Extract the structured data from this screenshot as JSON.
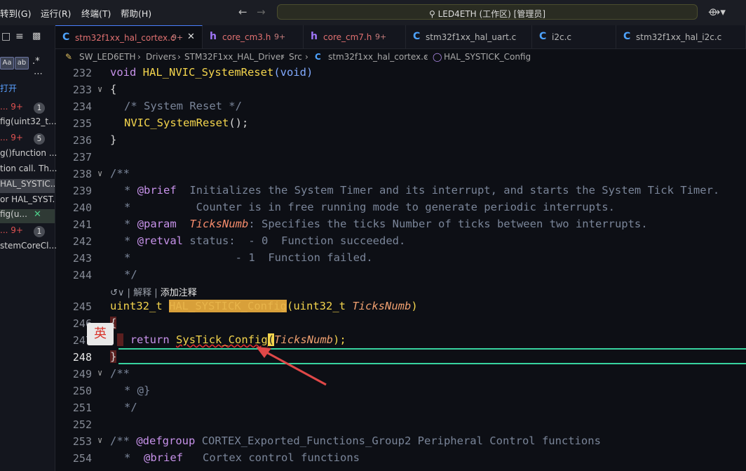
{
  "menu": [
    "转到(G)",
    "运行(R)",
    "终端(T)",
    "帮助(H)"
  ],
  "command_center": "LED4ETH (工作区) [管理员]",
  "left_panel": {
    "rows": [
      "打开",
      "... 9+",
      "fig(uint32_t...",
      "g()function ...",
      "tion call. Th...",
      "HAL_SYSTIC...",
      "or HAL_SYST...",
      "fig(u...",
      "... 9+",
      "stemCoreCl..."
    ],
    "badges": [
      "1",
      "5",
      "1"
    ],
    "toggles": [
      "Aa",
      "ab",
      ".*"
    ]
  },
  "tabs": [
    {
      "label": "stm32f1xx_hal_cortex.c",
      "icon": "C",
      "mod": "9+",
      "active": true
    },
    {
      "label": "core_cm3.h",
      "icon": "h",
      "mod": "9+"
    },
    {
      "label": "core_cm7.h",
      "icon": "h",
      "mod": "9+"
    },
    {
      "label": "stm32f1xx_hal_uart.c",
      "icon": "C"
    },
    {
      "label": "i2c.c",
      "icon": "C"
    },
    {
      "label": "stm32f1xx_hal_i2c.c",
      "icon": "C"
    }
  ],
  "breadcrumb": [
    "SW_LED6ETH",
    "Drivers",
    "STM32F1xx_HAL_Driver",
    "Src",
    "stm32f1xx_hal_cortex.c",
    "HAL_SYSTICK_Config"
  ],
  "codelens": {
    "explain": "解释",
    "add_comment": "添加注释"
  },
  "ime_indicator": "英",
  "line_numbers": [
    "232",
    "233",
    "234",
    "235",
    "236",
    "237",
    "238",
    "239",
    "240",
    "241",
    "242",
    "243",
    "244",
    "245",
    "246",
    "247",
    "248",
    "249",
    "250",
    "251",
    "252",
    "253",
    "254"
  ],
  "code": {
    "l232": [
      "void",
      "HAL_NVIC_SystemReset",
      "(void)"
    ],
    "l233": "{",
    "l234": "/* System Reset */",
    "l235": [
      "NVIC_SystemReset",
      "();"
    ],
    "l236": "}",
    "l238": "/**",
    "l239": [
      "*",
      "@brief",
      "Initializes the System Timer and its interrupt, and starts the System Tick Timer."
    ],
    "l240": [
      "*",
      "Counter is in free running mode to generate periodic interrupts."
    ],
    "l241": [
      "*",
      "@param",
      "TicksNumb",
      ": Specifies the ticks Number of ticks between two interrupts."
    ],
    "l242": [
      "*",
      "@retval",
      "status:  - 0  Function succeeded."
    ],
    "l243": [
      "*",
      "- 1  Function failed."
    ],
    "l244": "*/",
    "l245": [
      "uint32_t",
      "HAL_SYSTICK_Config",
      "(",
      "uint32_t",
      "TicksNumb",
      ")"
    ],
    "l246": "{",
    "l247": [
      "return",
      "SysTick_Config",
      "(",
      "TicksNumb",
      ");"
    ],
    "l248": "}",
    "l249": "/**",
    "l250": "* @}",
    "l251": "*/",
    "l253": [
      "/**",
      "@defgroup",
      "CORTEX_Exported_Functions_Group2 Peripheral Control functions"
    ],
    "l254": [
      "*",
      "@brief",
      "Cortex control functions"
    ]
  },
  "colors": {
    "accent": "#38d39f",
    "keyword": "#c792ea",
    "function": "#f4d54d",
    "type": "#82aaff",
    "comment": "#7a8599"
  }
}
